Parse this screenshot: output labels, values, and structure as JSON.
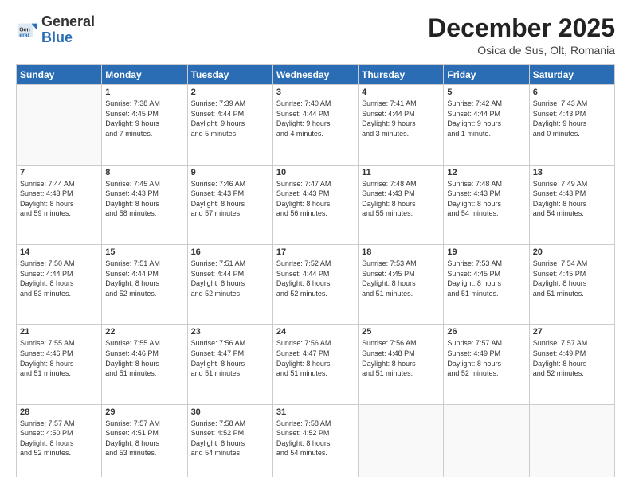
{
  "header": {
    "logo_general": "General",
    "logo_blue": "Blue",
    "month_title": "December 2025",
    "subtitle": "Osica de Sus, Olt, Romania"
  },
  "weekdays": [
    "Sunday",
    "Monday",
    "Tuesday",
    "Wednesday",
    "Thursday",
    "Friday",
    "Saturday"
  ],
  "weeks": [
    [
      {
        "day": "",
        "info": ""
      },
      {
        "day": "1",
        "info": "Sunrise: 7:38 AM\nSunset: 4:45 PM\nDaylight: 9 hours\nand 7 minutes."
      },
      {
        "day": "2",
        "info": "Sunrise: 7:39 AM\nSunset: 4:44 PM\nDaylight: 9 hours\nand 5 minutes."
      },
      {
        "day": "3",
        "info": "Sunrise: 7:40 AM\nSunset: 4:44 PM\nDaylight: 9 hours\nand 4 minutes."
      },
      {
        "day": "4",
        "info": "Sunrise: 7:41 AM\nSunset: 4:44 PM\nDaylight: 9 hours\nand 3 minutes."
      },
      {
        "day": "5",
        "info": "Sunrise: 7:42 AM\nSunset: 4:44 PM\nDaylight: 9 hours\nand 1 minute."
      },
      {
        "day": "6",
        "info": "Sunrise: 7:43 AM\nSunset: 4:43 PM\nDaylight: 9 hours\nand 0 minutes."
      }
    ],
    [
      {
        "day": "7",
        "info": "Sunrise: 7:44 AM\nSunset: 4:43 PM\nDaylight: 8 hours\nand 59 minutes."
      },
      {
        "day": "8",
        "info": "Sunrise: 7:45 AM\nSunset: 4:43 PM\nDaylight: 8 hours\nand 58 minutes."
      },
      {
        "day": "9",
        "info": "Sunrise: 7:46 AM\nSunset: 4:43 PM\nDaylight: 8 hours\nand 57 minutes."
      },
      {
        "day": "10",
        "info": "Sunrise: 7:47 AM\nSunset: 4:43 PM\nDaylight: 8 hours\nand 56 minutes."
      },
      {
        "day": "11",
        "info": "Sunrise: 7:48 AM\nSunset: 4:43 PM\nDaylight: 8 hours\nand 55 minutes."
      },
      {
        "day": "12",
        "info": "Sunrise: 7:48 AM\nSunset: 4:43 PM\nDaylight: 8 hours\nand 54 minutes."
      },
      {
        "day": "13",
        "info": "Sunrise: 7:49 AM\nSunset: 4:43 PM\nDaylight: 8 hours\nand 54 minutes."
      }
    ],
    [
      {
        "day": "14",
        "info": "Sunrise: 7:50 AM\nSunset: 4:44 PM\nDaylight: 8 hours\nand 53 minutes."
      },
      {
        "day": "15",
        "info": "Sunrise: 7:51 AM\nSunset: 4:44 PM\nDaylight: 8 hours\nand 52 minutes."
      },
      {
        "day": "16",
        "info": "Sunrise: 7:51 AM\nSunset: 4:44 PM\nDaylight: 8 hours\nand 52 minutes."
      },
      {
        "day": "17",
        "info": "Sunrise: 7:52 AM\nSunset: 4:44 PM\nDaylight: 8 hours\nand 52 minutes."
      },
      {
        "day": "18",
        "info": "Sunrise: 7:53 AM\nSunset: 4:45 PM\nDaylight: 8 hours\nand 51 minutes."
      },
      {
        "day": "19",
        "info": "Sunrise: 7:53 AM\nSunset: 4:45 PM\nDaylight: 8 hours\nand 51 minutes."
      },
      {
        "day": "20",
        "info": "Sunrise: 7:54 AM\nSunset: 4:45 PM\nDaylight: 8 hours\nand 51 minutes."
      }
    ],
    [
      {
        "day": "21",
        "info": "Sunrise: 7:55 AM\nSunset: 4:46 PM\nDaylight: 8 hours\nand 51 minutes."
      },
      {
        "day": "22",
        "info": "Sunrise: 7:55 AM\nSunset: 4:46 PM\nDaylight: 8 hours\nand 51 minutes."
      },
      {
        "day": "23",
        "info": "Sunrise: 7:56 AM\nSunset: 4:47 PM\nDaylight: 8 hours\nand 51 minutes."
      },
      {
        "day": "24",
        "info": "Sunrise: 7:56 AM\nSunset: 4:47 PM\nDaylight: 8 hours\nand 51 minutes."
      },
      {
        "day": "25",
        "info": "Sunrise: 7:56 AM\nSunset: 4:48 PM\nDaylight: 8 hours\nand 51 minutes."
      },
      {
        "day": "26",
        "info": "Sunrise: 7:57 AM\nSunset: 4:49 PM\nDaylight: 8 hours\nand 52 minutes."
      },
      {
        "day": "27",
        "info": "Sunrise: 7:57 AM\nSunset: 4:49 PM\nDaylight: 8 hours\nand 52 minutes."
      }
    ],
    [
      {
        "day": "28",
        "info": "Sunrise: 7:57 AM\nSunset: 4:50 PM\nDaylight: 8 hours\nand 52 minutes."
      },
      {
        "day": "29",
        "info": "Sunrise: 7:57 AM\nSunset: 4:51 PM\nDaylight: 8 hours\nand 53 minutes."
      },
      {
        "day": "30",
        "info": "Sunrise: 7:58 AM\nSunset: 4:52 PM\nDaylight: 8 hours\nand 54 minutes."
      },
      {
        "day": "31",
        "info": "Sunrise: 7:58 AM\nSunset: 4:52 PM\nDaylight: 8 hours\nand 54 minutes."
      },
      {
        "day": "",
        "info": ""
      },
      {
        "day": "",
        "info": ""
      },
      {
        "day": "",
        "info": ""
      }
    ]
  ]
}
